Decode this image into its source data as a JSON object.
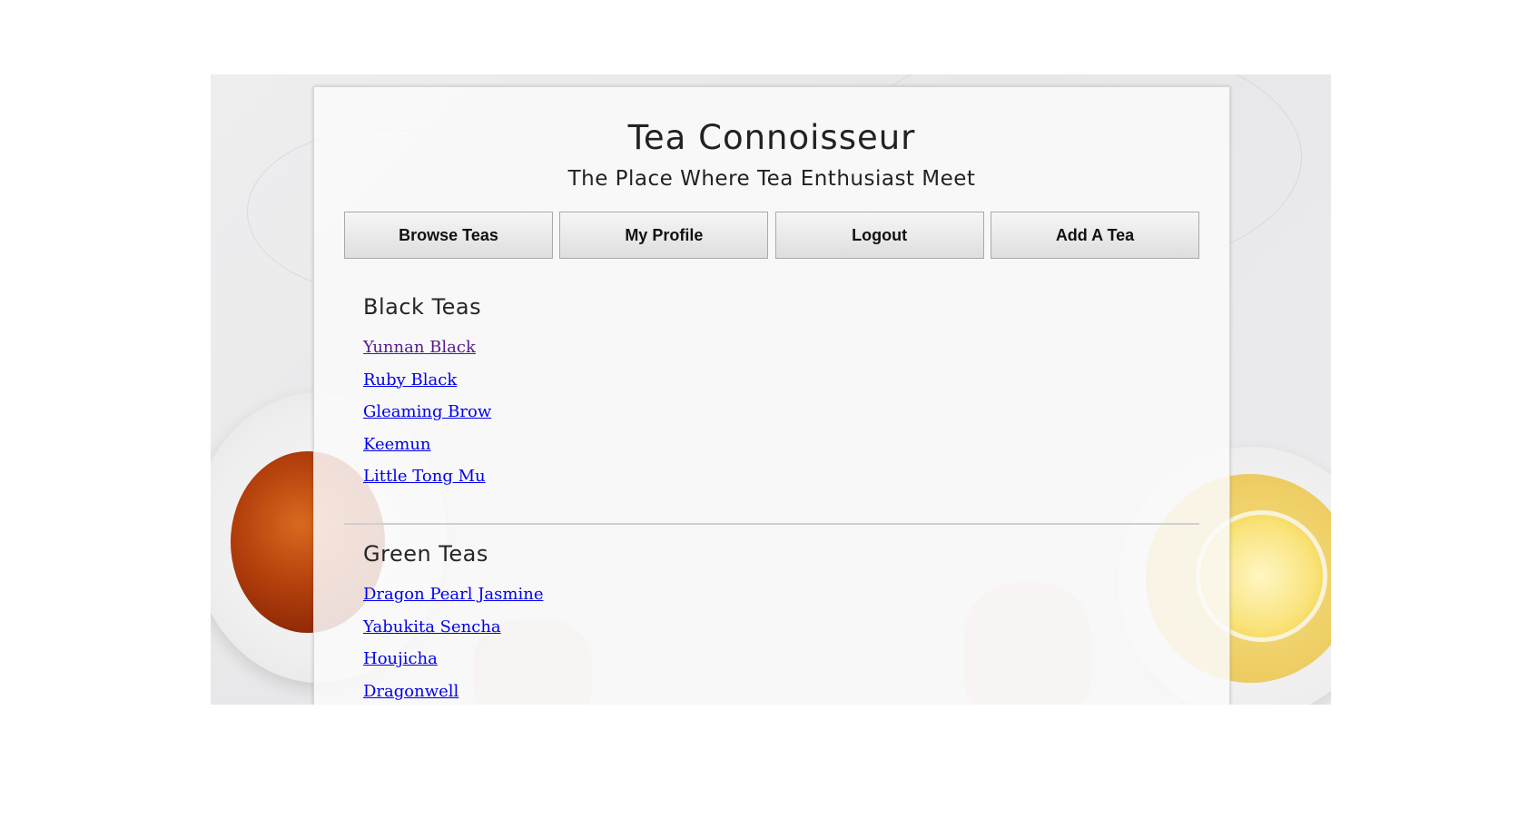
{
  "header": {
    "title": "Tea Connoisseur",
    "subtitle": "The Place Where Tea Enthusiast Meet"
  },
  "nav": {
    "items": [
      {
        "label": "Browse Teas"
      },
      {
        "label": "My Profile"
      },
      {
        "label": "Logout"
      },
      {
        "label": "Add A Tea"
      }
    ]
  },
  "sections": [
    {
      "heading": "Black Teas",
      "teas": [
        "Yunnan Black",
        "Ruby Black",
        "Gleaming Brow",
        "Keemun",
        "Little Tong Mu"
      ]
    },
    {
      "heading": "Green Teas",
      "teas": [
        "Dragon Pearl Jasmine",
        "Yabukita Sencha",
        "Houjicha",
        "Dragonwell"
      ]
    }
  ],
  "colors": {
    "link": "#0000ee",
    "visited_link": "#551a8b"
  }
}
